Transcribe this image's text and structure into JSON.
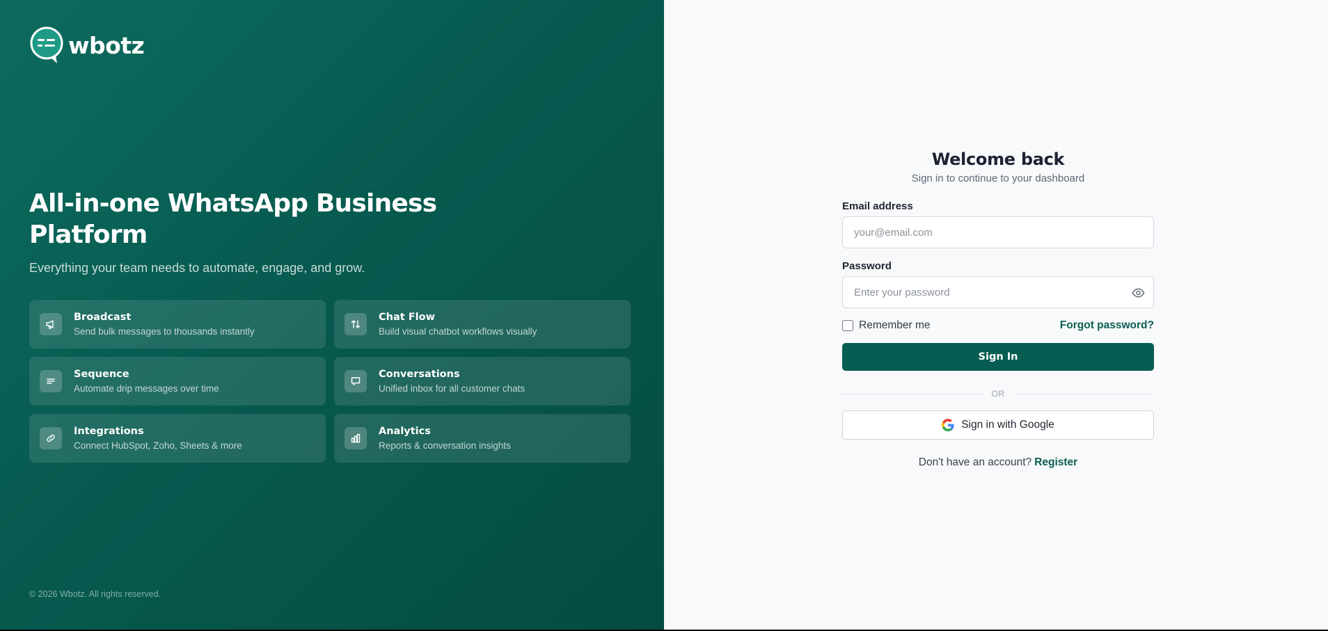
{
  "brand": {
    "name": "wbotz"
  },
  "hero": {
    "title": "All-in-one WhatsApp Business Platform",
    "subtitle": "Everything your team needs to automate, engage, and grow."
  },
  "features": [
    {
      "title": "Broadcast",
      "description": "Send bulk messages to thousands instantly",
      "icon": "megaphone-icon"
    },
    {
      "title": "Chat Flow",
      "description": "Build visual chatbot workflows visually",
      "icon": "arrows-up-down-icon"
    },
    {
      "title": "Sequence",
      "description": "Automate drip messages over time",
      "icon": "lines-icon"
    },
    {
      "title": "Conversations",
      "description": "Unified inbox for all customer chats",
      "icon": "chat-bubble-icon"
    },
    {
      "title": "Integrations",
      "description": "Connect HubSpot, Zoho, Sheets & more",
      "icon": "link-icon"
    },
    {
      "title": "Analytics",
      "description": "Reports & conversation insights",
      "icon": "bar-chart-icon"
    }
  ],
  "footer": {
    "copyright": "© 2026 Wbotz. All rights reserved."
  },
  "login": {
    "title": "Welcome back",
    "subtitle": "Sign in to continue to your dashboard",
    "email_label": "Email address",
    "email_placeholder": "your@email.com",
    "password_label": "Password",
    "password_placeholder": "Enter your password",
    "remember_label": "Remember me",
    "remember_checked": false,
    "forgot_label": "Forgot password?",
    "signin_label": "Sign In",
    "or_label": "OR",
    "google_label": "Sign in with Google",
    "no_account_text": "Don't have an account?",
    "register_label": "Register"
  },
  "colors": {
    "brand_primary": "#085d52",
    "panel_dark": "#054c42",
    "panel_light": "#0d6b5e",
    "right_bg": "#f8f9fb"
  }
}
